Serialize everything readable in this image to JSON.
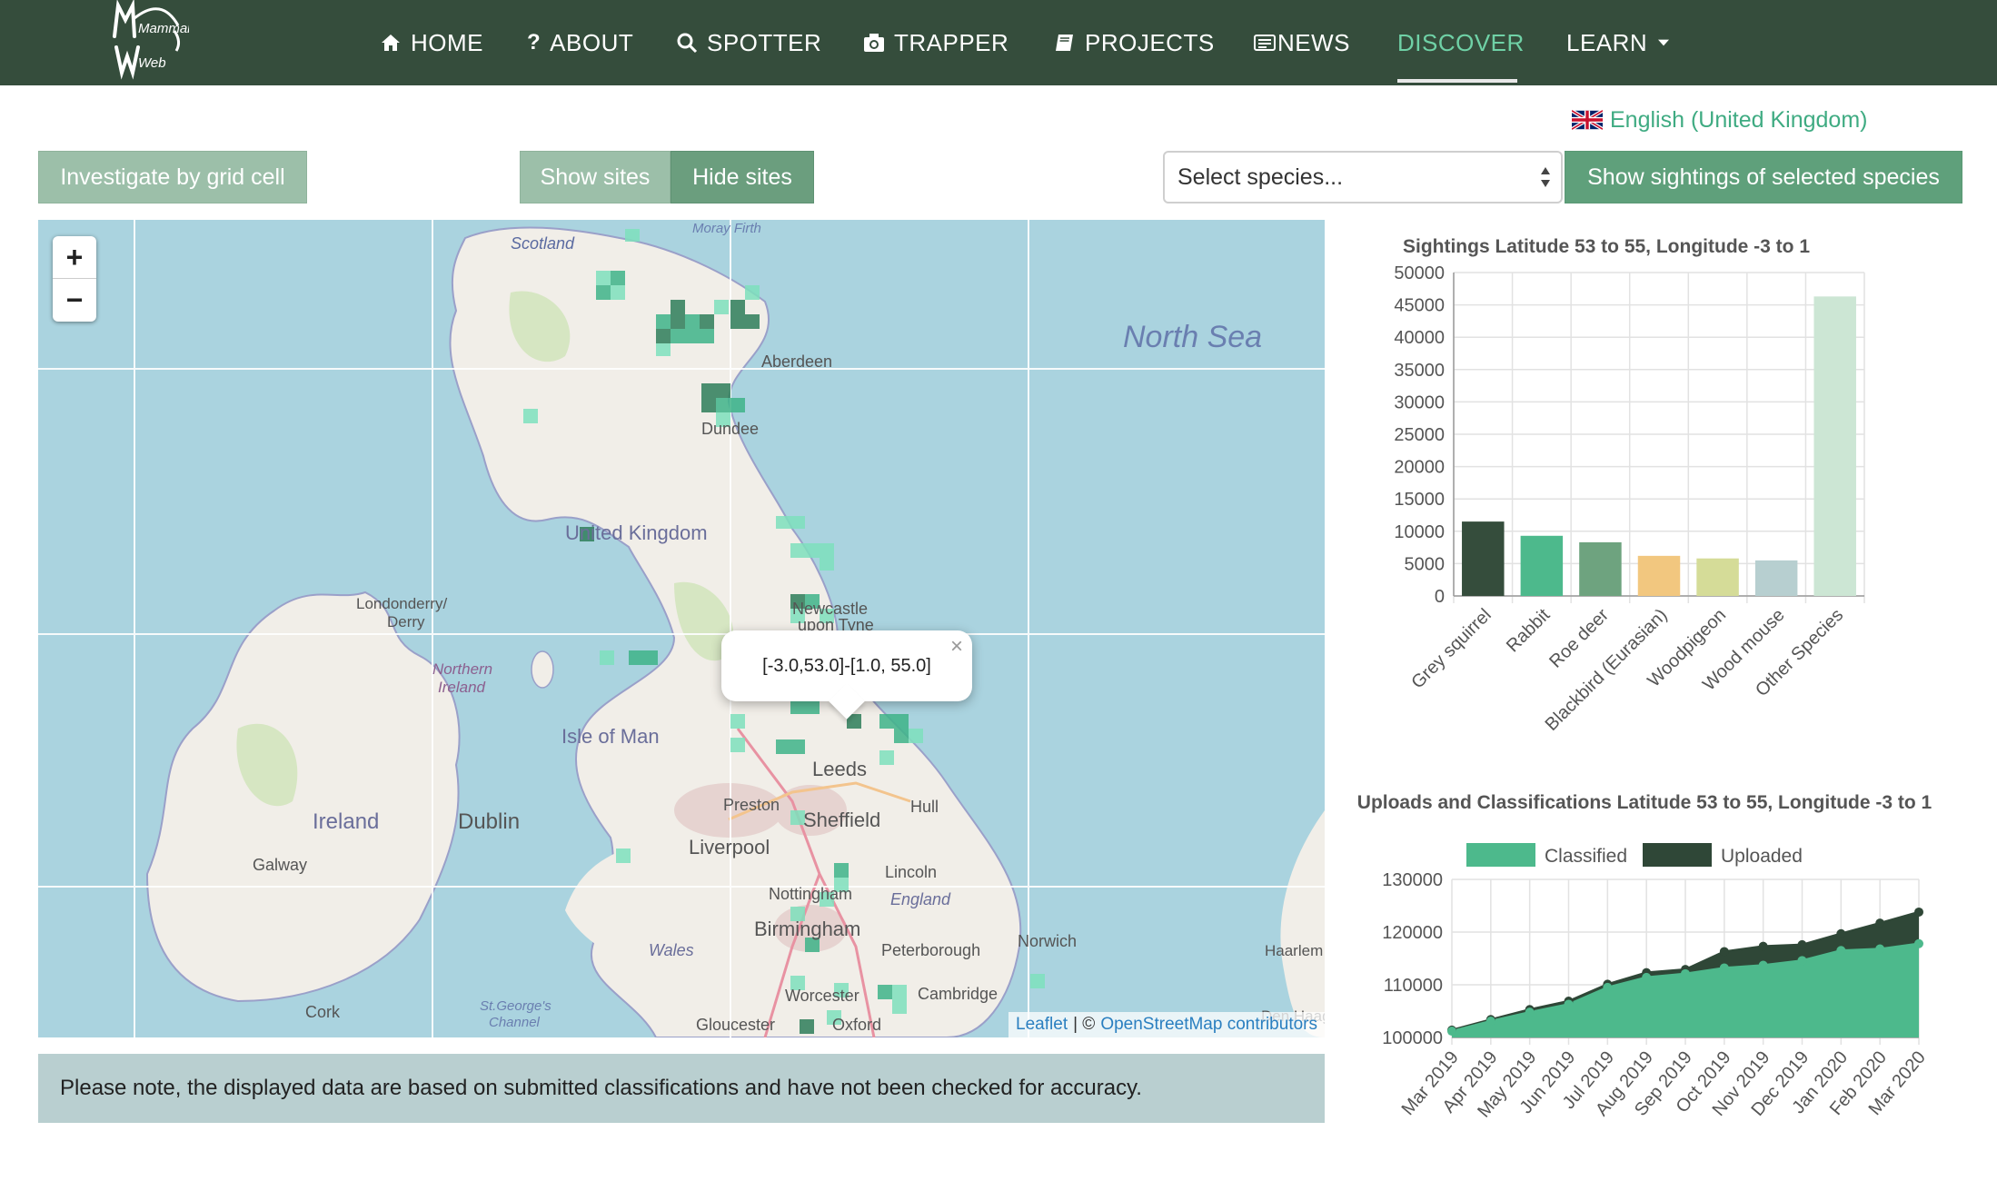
{
  "brand": {
    "logo_text_1": "Mammal",
    "logo_text_2": "Web"
  },
  "nav": {
    "items": [
      {
        "label": "HOME",
        "icon": "home-icon"
      },
      {
        "label": "ABOUT",
        "icon": "question-icon"
      },
      {
        "label": "SPOTTER",
        "icon": "search-icon"
      },
      {
        "label": "TRAPPER",
        "icon": "camera-icon"
      },
      {
        "label": "PROJECTS",
        "icon": "book-icon"
      },
      {
        "label": "NEWS",
        "icon": "newspaper-icon"
      },
      {
        "label": "DISCOVER",
        "icon": "",
        "active": true
      },
      {
        "label": "LEARN",
        "icon": "caret-down-icon"
      }
    ]
  },
  "language": {
    "label": "English (United Kingdom)",
    "icon": "uk-flag-icon"
  },
  "controls": {
    "grid_button": "Investigate by grid cell",
    "show_sites": "Show sites",
    "hide_sites": "Hide sites",
    "species_select": "Select species...",
    "show_sightings": "Show sightings of selected species"
  },
  "map": {
    "zoom_in": "+",
    "zoom_out": "−",
    "popup_text": "[-3.0,53.0]-[1.0, 55.0]",
    "popup_close": "×",
    "labels": {
      "north_sea": "North Sea",
      "scotland": "Scotland",
      "moray_firth": "Moray Firth",
      "aberdeen": "Aberdeen",
      "dundee": "Dundee",
      "united_kingdom": "United Kingdom",
      "londonderry": "Londonderry/",
      "derry": "Derry",
      "northern": "Northern",
      "ireland_ni": "Ireland",
      "isle_of_man": "Isle of Man",
      "ireland": "Ireland",
      "dublin": "Dublin",
      "galway": "Galway",
      "cork": "Cork",
      "newcastle": "Newcastle",
      "upon_tyne": "upon Tyne",
      "leeds": "Leeds",
      "preston": "Preston",
      "hull": "Hull",
      "sheffield": "Sheffield",
      "liverpool": "Liverpool",
      "lincoln": "Lincoln",
      "nottingham": "Nottingham",
      "england": "England",
      "birmingham": "Birmingham",
      "peterborough": "Peterborough",
      "norwich": "Norwich",
      "wales": "Wales",
      "worcester": "Worcester",
      "cambridge": "Cambridge",
      "gloucester": "Gloucester",
      "oxford": "Oxford",
      "st_georges": "St.George's",
      "channel": "Channel",
      "haarlem": "Haarlem",
      "den_haag": "Den Haag"
    },
    "attribution_leaflet": "Leaflet",
    "attribution_sep": "| ©",
    "attribution_osm": "OpenStreetMap contributors"
  },
  "note": "Please note, the displayed data are based on submitted classifications and have not been checked for accuracy.",
  "chart_data": [
    {
      "type": "bar",
      "title": "Sightings Latitude 53 to 55, Longitude -3 to 1",
      "categories": [
        "Grey squirrel",
        "Rabbit",
        "Roe deer",
        "Blackbird (Eurasian)",
        "Woodpigeon",
        "Wood mouse",
        "Other Species"
      ],
      "values": [
        11500,
        9300,
        8300,
        6200,
        5800,
        5500,
        46300
      ],
      "colors": [
        "#354d3c",
        "#4db98c",
        "#6ea37f",
        "#f2c77f",
        "#d5dc98",
        "#b7cfd0",
        "#cce6d4"
      ],
      "ylim": [
        0,
        50000
      ],
      "yticks": [
        0,
        5000,
        10000,
        15000,
        20000,
        25000,
        30000,
        35000,
        40000,
        45000,
        50000
      ],
      "grid": true
    },
    {
      "type": "area",
      "title": "Uploads and Classifications Latitude 53 to 55, Longitude -3 to 1",
      "x": [
        "Mar 2019",
        "Apr 2019",
        "May 2019",
        "Jun 2019",
        "Jul 2019",
        "Aug 2019",
        "Sep 2019",
        "Oct 2019",
        "Nov 2019",
        "Dec 2019",
        "Jan 2020",
        "Feb 2020",
        "Mar 2020"
      ],
      "series": [
        {
          "name": "Classified",
          "color": "#4db98c",
          "values": [
            101200,
            103100,
            104800,
            106300,
            109500,
            111400,
            112100,
            113200,
            113700,
            114600,
            116500,
            116800,
            117800
          ]
        },
        {
          "name": "Uploaded",
          "color": "#2f4737",
          "values": [
            101400,
            103400,
            105300,
            106900,
            110100,
            112300,
            112900,
            116300,
            117300,
            117600,
            119700,
            121700,
            123800
          ]
        }
      ],
      "ylim": [
        100000,
        130000
      ],
      "yticks": [
        100000,
        110000,
        120000,
        130000
      ],
      "legend": "top",
      "grid": true
    }
  ]
}
